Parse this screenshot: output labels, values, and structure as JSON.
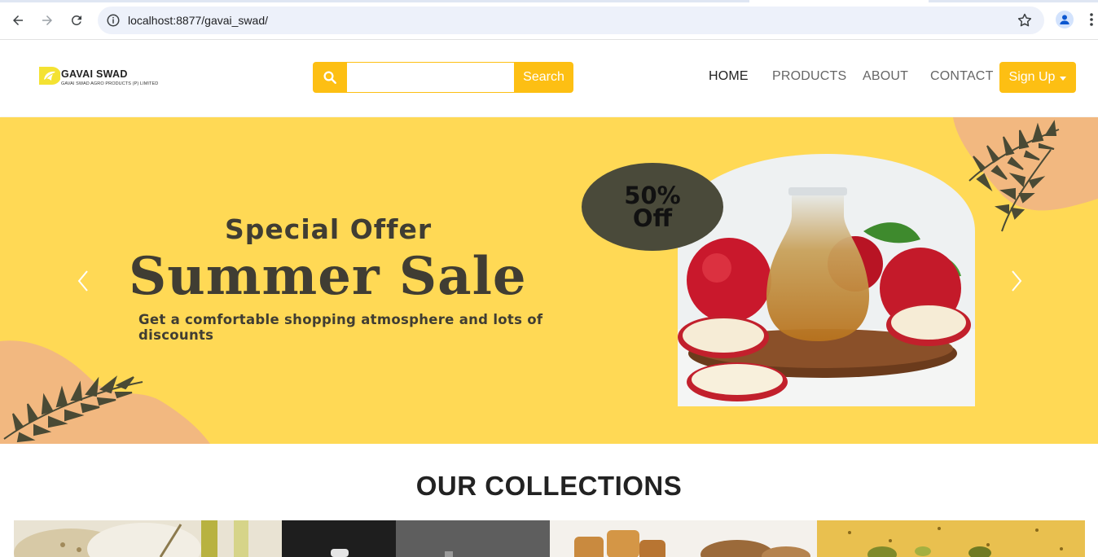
{
  "browser": {
    "url": "localhost:8877/gavai_swad/",
    "back_icon": "arrow-left-icon",
    "forward_icon": "arrow-right-icon",
    "reload_icon": "reload-icon",
    "info_icon": "info-icon",
    "bookmark_icon": "star-icon",
    "profile_icon": "profile-icon",
    "menu_icon": "kebab-menu-icon"
  },
  "header": {
    "brand": "GAVAI SWAD",
    "brand_sub": "GAVAI SWAD AGRO PRODUCTS (P) LIMITED",
    "search": {
      "placeholder": "",
      "value": "",
      "button_label": "Search",
      "icon": "search-icon"
    },
    "nav": [
      {
        "label": "HOME",
        "active": true
      },
      {
        "label": "PRODUCTS",
        "active": false
      },
      {
        "label": "ABOUT",
        "active": false
      },
      {
        "label": "CONTACT",
        "active": false
      }
    ],
    "signup_label": "Sign Up"
  },
  "hero": {
    "pre_title": "Special Offer",
    "title": "Summer Sale",
    "description": "Get a comfortable shopping atmosphere and lots of discounts",
    "badge_line1": "50%",
    "badge_line2": "Off",
    "prev_icon": "chevron-left-icon",
    "next_icon": "chevron-right-icon"
  },
  "collections": {
    "title": "OUR COLLECTIONS"
  },
  "colors": {
    "accent": "#fdbf13",
    "hero_bg": "#ffd955",
    "hero_text": "#403d33",
    "badge_bg": "#4a4a3a",
    "peach": "#f2b880",
    "leaf": "#4a4a35"
  }
}
